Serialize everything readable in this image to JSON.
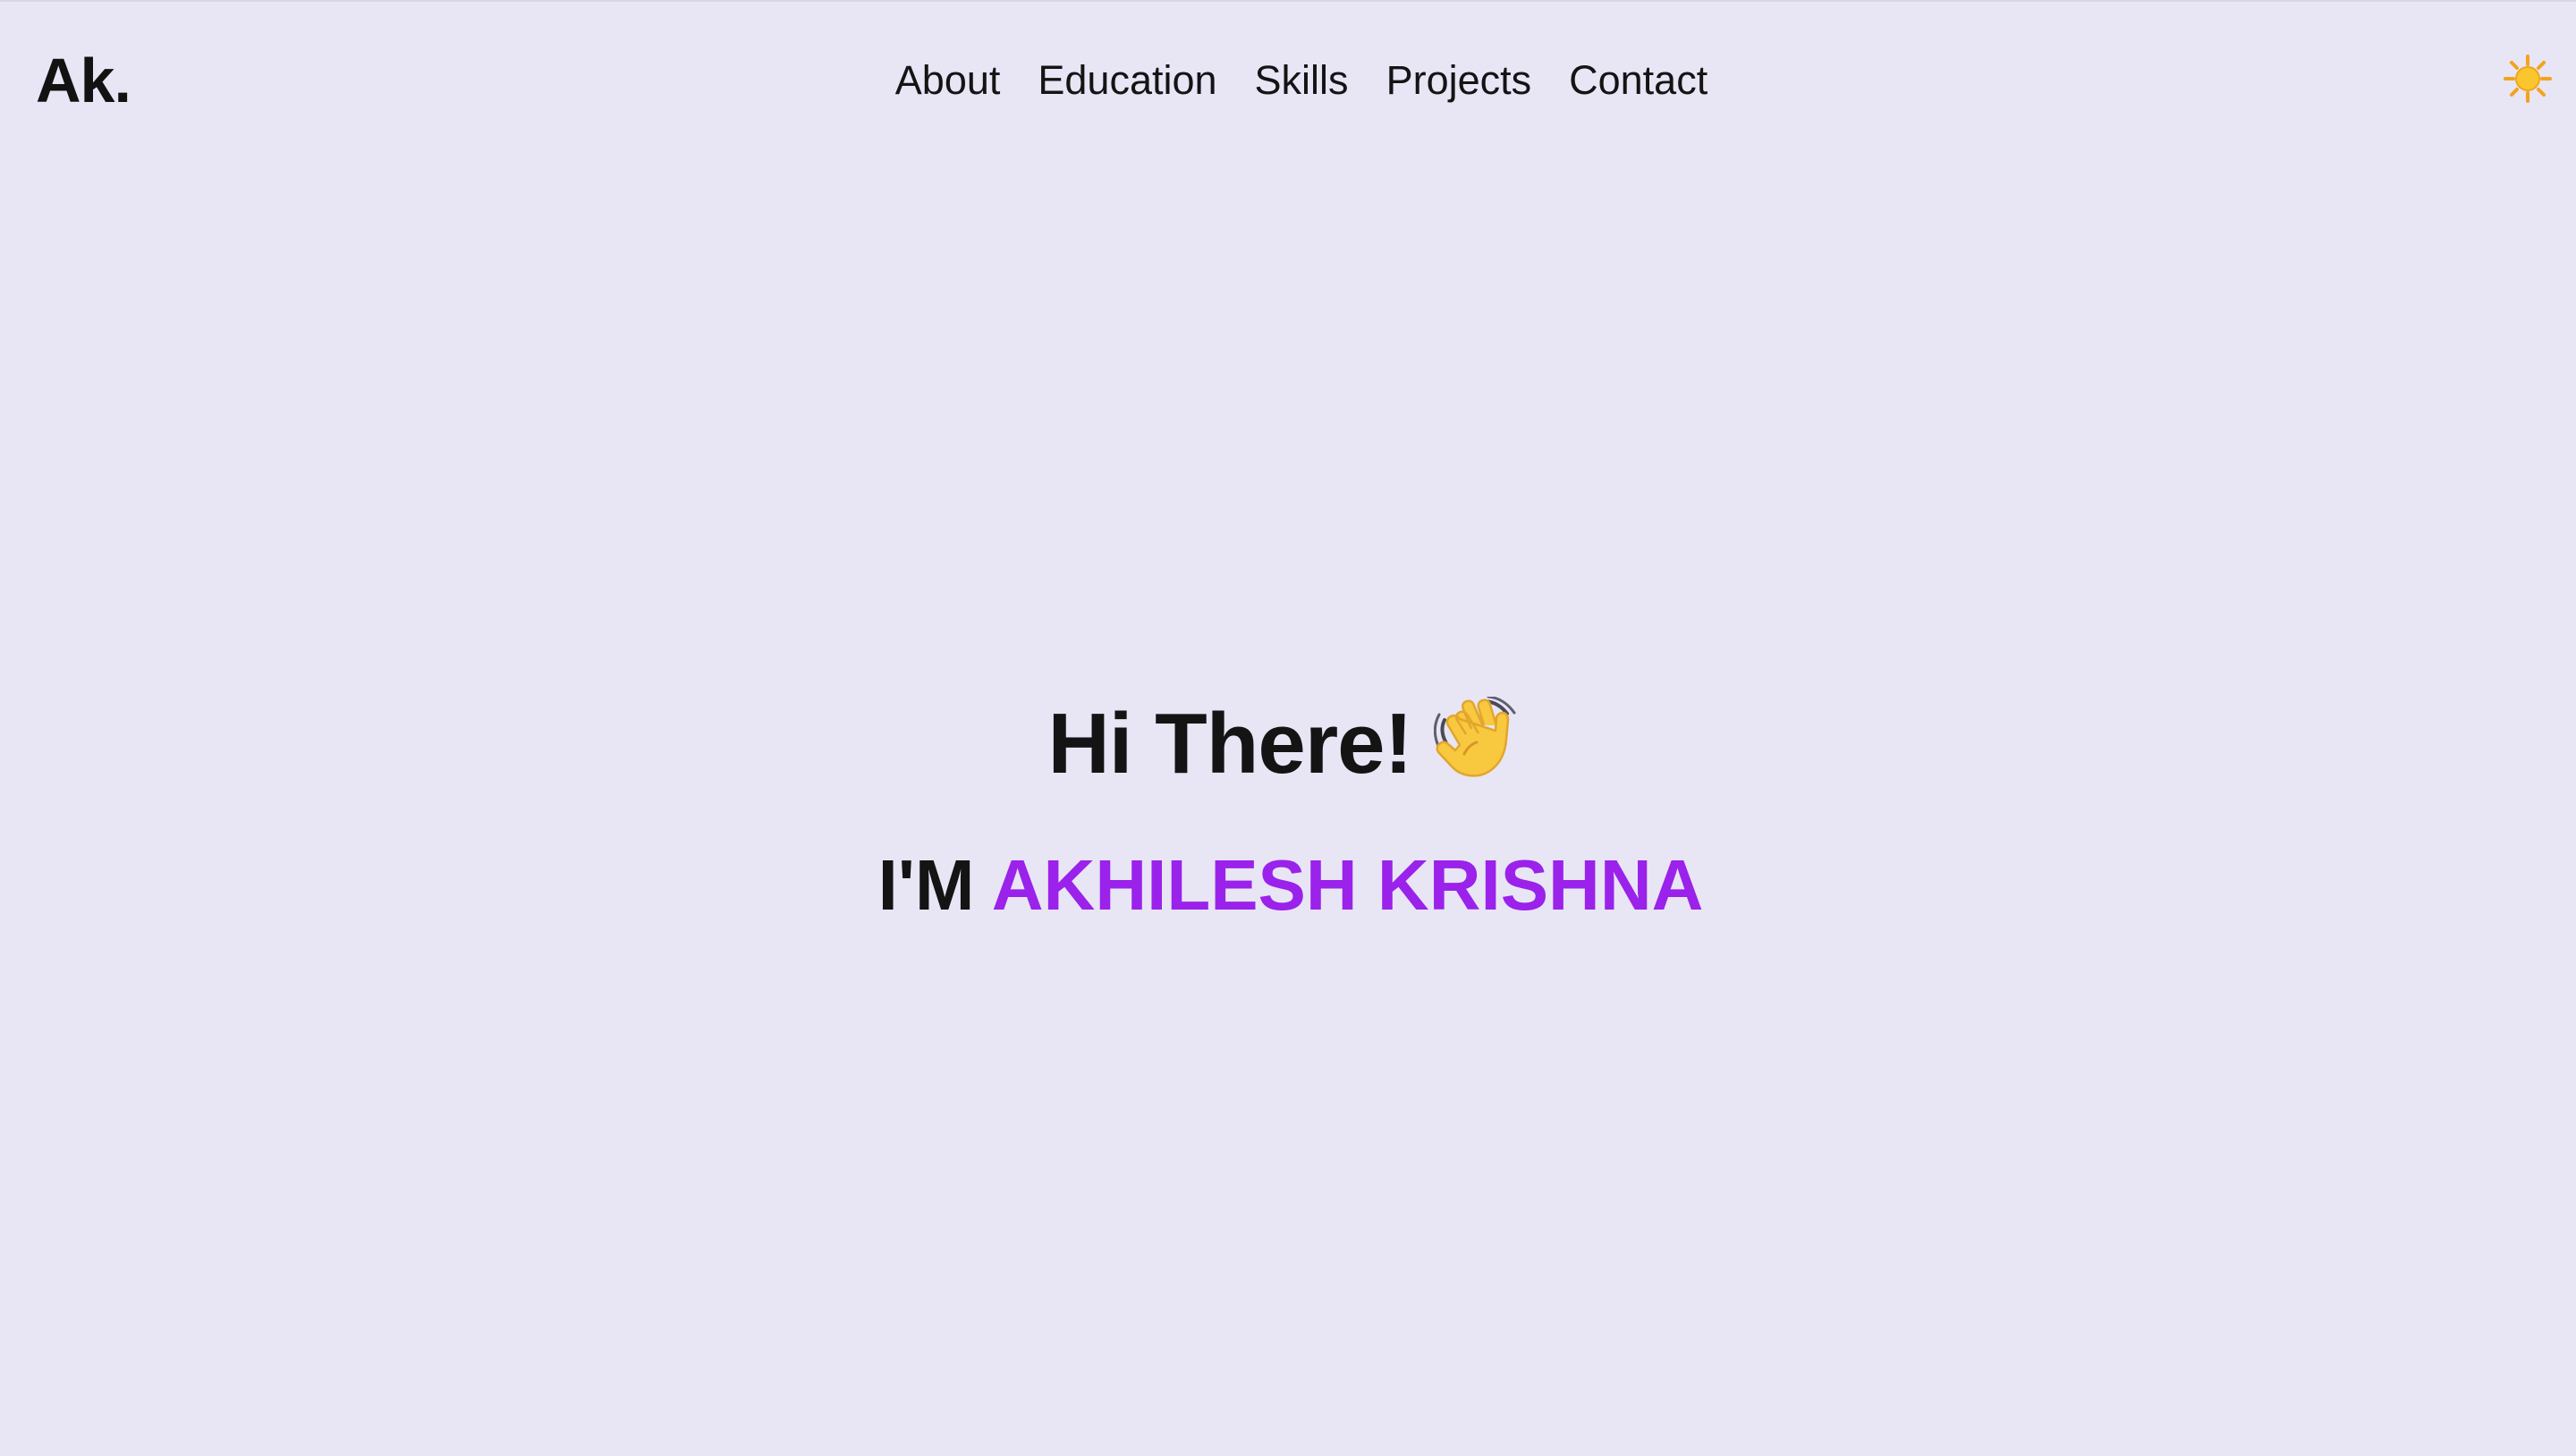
{
  "brand": {
    "logo_text": "Ak."
  },
  "nav": {
    "items": [
      {
        "label": "About"
      },
      {
        "label": "Education"
      },
      {
        "label": "Skills"
      },
      {
        "label": "Projects"
      },
      {
        "label": "Contact"
      }
    ],
    "theme_toggle_icon": "sun-icon"
  },
  "hero": {
    "greeting": "Hi There!",
    "greeting_icon": "waving-hand-icon",
    "intro_prefix": "I'M",
    "name": "AKHILESH KRISHNA"
  },
  "colors": {
    "background": "#e8e5f5",
    "text": "#141414",
    "accent": "#9a22ea",
    "sun": "#f7b21f"
  }
}
